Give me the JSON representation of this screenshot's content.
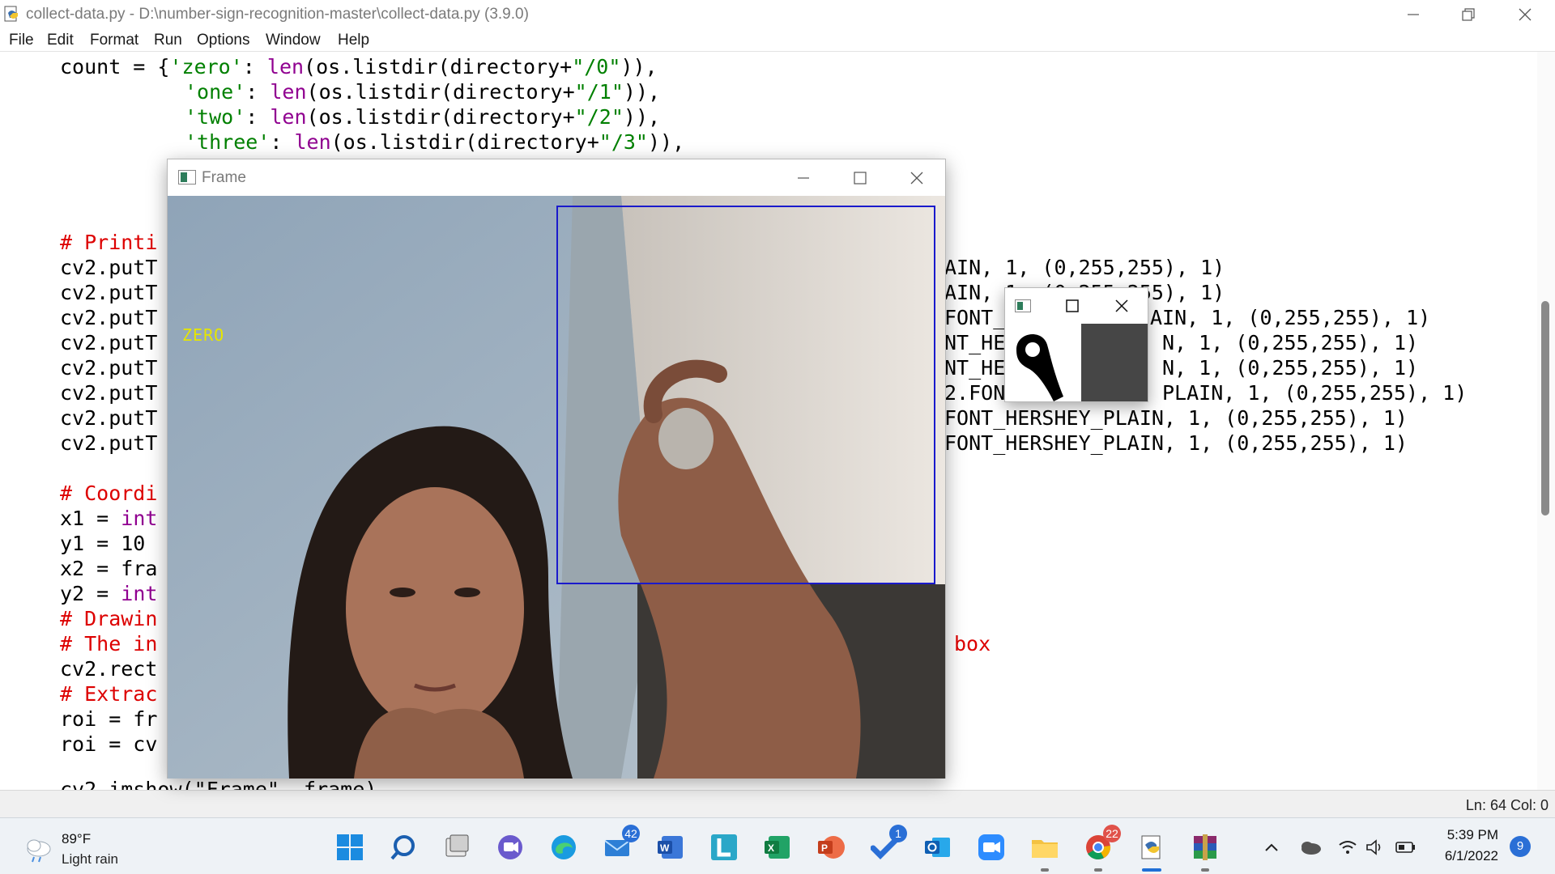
{
  "idle_window": {
    "title": "collect-data.py - D:\\number-sign-recognition-master\\collect-data.py (3.9.0)",
    "menu": [
      "File",
      "Edit",
      "Format",
      "Run",
      "Options",
      "Window",
      "Help"
    ],
    "status": "Ln: 64  Col: 0"
  },
  "code": {
    "l1a": "count = {",
    "l1b": "'zero'",
    "l1c": ": ",
    "l1d": "len",
    "l1e": "(os.listdir(directory+",
    "l1f": "\"/0\"",
    "l1g": ")),",
    "l2b": "'one'",
    "l2c": ": ",
    "l2d": "len",
    "l2e": "(os.listdir(directory+",
    "l2f": "\"/1\"",
    "l2g": ")),",
    "l3b": "'two'",
    "l3c": ": ",
    "l3d": "len",
    "l3e": "(os.listdir(directory+",
    "l3f": "\"/2\"",
    "l3g": ")),",
    "l4b": "'three'",
    "l4c": ": ",
    "l4d": "len",
    "l4e": "(os.listdir(directory+",
    "l4f": "\"/3\"",
    "l4g": ")),",
    "comment_print": "# Printi",
    "puts": [
      "cv2.putT",
      "cv2.putT",
      "cv2.putT",
      "cv2.putT",
      "cv2.putT",
      "cv2.putT",
      "cv2.putT",
      "cv2.putT"
    ],
    "put_tails": [
      "AIN, 1, (0,255,255), 1)",
      "AIN, 1, (0,255,255), 1)",
      "AIN, 1, (0,255,255), 1)",
      "N, 1, (0,255,255), 1)",
      "N, 1, (0,255,255), 1)",
      "PLAIN, 1, (0,255,255), 1)",
      "FONT_HERSHEY_PLAIN, 1, (0,255,255), 1)",
      "FONT_HERSHEY_PLAIN, 1, (0,255,255), 1)"
    ],
    "put_mid": [
      "FONT_",
      "NT_HE",
      "NT_HE",
      "2.FON"
    ],
    "comment_coord": "# Coordi",
    "x1": "x1 = ",
    "x1b": "int",
    "y1": "y1 = 10",
    "x2": "x2 = fra",
    "y2": "y2 = ",
    "y2b": "int",
    "comment_draw": "# Drawin",
    "comment_the": "# The in",
    "comment_box": "box",
    "rect": "cv2.rect",
    "comment_extract": "# Extrac",
    "roi1": "roi = fr",
    "roi2": "roi = cv",
    "imshow": "cv2.imshow(\"Frame\", frame)"
  },
  "frame_window": {
    "title": "Frame",
    "overlay_label": "ZERO"
  },
  "taskbar": {
    "weather_temp": "89°F",
    "weather_desc": "Light rain",
    "mail_badge": "42",
    "todo_badge": "1",
    "chrome_badge": "22",
    "time": "5:39 PM",
    "date": "6/1/2022",
    "notifications": "9"
  },
  "colors": {
    "keyword": "#900090",
    "string": "#008000",
    "comment": "#dd0000",
    "roi_box": "#1a1acc",
    "overlay_text": "#e6e600"
  }
}
